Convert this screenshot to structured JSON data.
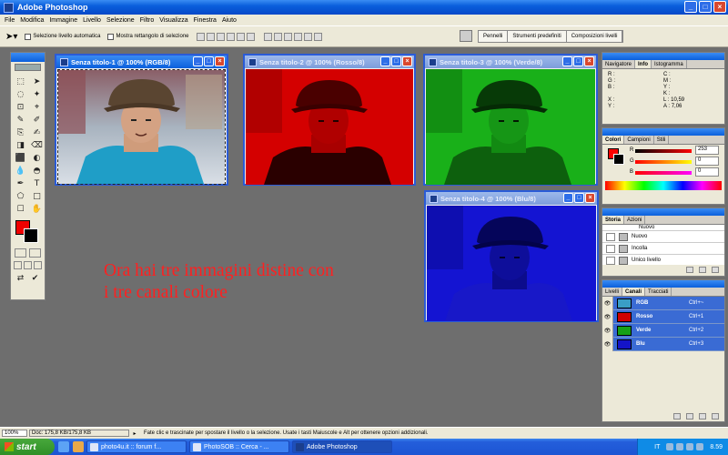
{
  "window": {
    "title": "Adobe Photoshop",
    "controls": [
      "_",
      "□",
      "×"
    ]
  },
  "menu": [
    "File",
    "Modifica",
    "Immagine",
    "Livello",
    "Selezione",
    "Filtro",
    "Visualizza",
    "Finestra",
    "Aiuto"
  ],
  "options": {
    "auto_select_label": "Selezione livello automatica",
    "show_bounds_label": "Mostra rettangolo di selezione",
    "palette_well_tabs": [
      "Pennelli",
      "Strumenti predefiniti",
      "Composizioni livelli"
    ]
  },
  "toolbox": {
    "tools": [
      "⬚",
      "➤",
      "◌",
      "✦",
      "⊡",
      "⌖",
      "✎",
      "✐",
      "⎘",
      "✍",
      "◨",
      "⌫",
      "⬛",
      "◐",
      "💧",
      "◓",
      "✒",
      "T",
      "⬠",
      "□",
      "☐",
      "✋",
      "✋",
      "🔍"
    ],
    "foreground_color": "#f00000",
    "background_color": "#000000"
  },
  "documents": [
    {
      "title": "Senza titolo-1 @ 100% (RGB/8)",
      "channel": "rgb"
    },
    {
      "title": "Senza titolo-2 @ 100% (Rosso/8)",
      "channel": "red"
    },
    {
      "title": "Senza titolo-3 @ 100% (Verde/8)",
      "channel": "green"
    },
    {
      "title": "Senza titolo-4 @ 100% (Blu/8)",
      "channel": "blue"
    }
  ],
  "overlay_text": {
    "line1": "Ora hai tre immagini distine con",
    "line2": "i tre canali colore",
    "color": "#ff2020"
  },
  "info_panel": {
    "tabs": [
      "Navigatore",
      "Info",
      "Istogramma"
    ],
    "left_labels": [
      "R :",
      "G :",
      "B :"
    ],
    "right_labels": [
      "C :",
      "M :",
      "Y :",
      "K :"
    ],
    "xy_labels": [
      "X :",
      "Y :"
    ],
    "size_labels": [
      "L :",
      "A :"
    ],
    "width_value": "10,59",
    "height_value": "7,06"
  },
  "color_panel": {
    "tabs": [
      "Colori",
      "Campioni",
      "Stili"
    ],
    "channels": [
      {
        "label": "R",
        "value": "253"
      },
      {
        "label": "G",
        "value": "0"
      },
      {
        "label": "B",
        "value": "0"
      }
    ]
  },
  "history_panel": {
    "tabs": [
      "Storia",
      "Azioni"
    ],
    "items": [
      "Nuovo",
      "Nuovo",
      "Incolla",
      "Unico livello"
    ]
  },
  "channels_panel": {
    "tabs": [
      "Livelli",
      "Canali",
      "Tracciati"
    ],
    "rows": [
      {
        "name": "RGB",
        "shortcut": "Ctrl+~"
      },
      {
        "name": "Rosso",
        "shortcut": "Ctrl+1"
      },
      {
        "name": "Verde",
        "shortcut": "Ctrl+2"
      },
      {
        "name": "Blu",
        "shortcut": "Ctrl+3"
      }
    ]
  },
  "statusbar": {
    "zoom": "100%",
    "doc": "Doc: 175,8 KB/175,8 KB",
    "message": "Fate clic e trascinate per spostare il livello o la selezione.  Usate i tasti Maiuscole e Alt per ottenere opzioni addizionali."
  },
  "taskbar": {
    "start_label": "start",
    "buttons": [
      "photo4u.it :: forum f...",
      "PhotoSOB :: Cerca - ...",
      "Adobe Photoshop"
    ],
    "lang": "IT",
    "clock": "8.59"
  }
}
